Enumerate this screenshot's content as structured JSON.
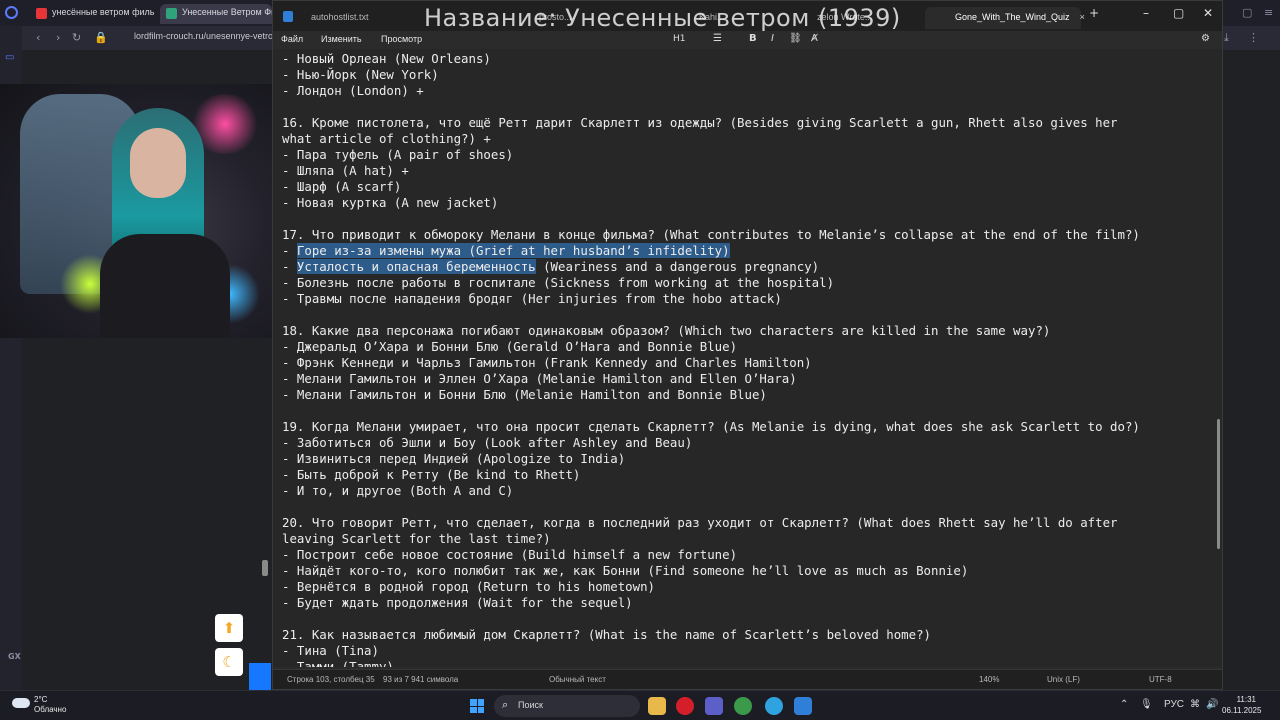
{
  "overlay_title": "Название: Унесенные ветром (1939)",
  "browser": {
    "tabs": [
      {
        "label": "унесённые ветром филь",
        "icon": "yandex-icon",
        "color": "#e8353a"
      },
      {
        "label": "Унесенные Ветром Фи",
        "icon": "film-icon",
        "color": "#2fa37a"
      }
    ],
    "url": "lordfilm-crouch.ru/unesennye-vetrom-",
    "sidebar_label": "GX"
  },
  "notepad": {
    "tabs": [
      {
        "label": "autohostlist.txt"
      },
      {
        "label": "prosto..."
      },
      {
        "label": "Kahi..."
      },
      {
        "label": "zelon Wrote..."
      },
      {
        "label": "Gone_With_The_Wind_Quiz"
      }
    ],
    "menu": {
      "file": "Файл",
      "edit": "Изменить",
      "view": "Просмотр"
    },
    "format": {
      "heading": "H1",
      "bold": "B",
      "italic": "I"
    },
    "lines": [
      "- Новый Орлеан (New Orleans)",
      "- Нью-Йорк (New York)",
      "- Лондон (London) +",
      "",
      "16. Кроме пистолета, что ещё Ретт дарит Скарлетт из одежды? (Besides giving Scarlett a gun, Rhett also gives her",
      "what article of clothing?) +",
      "- Пара туфель (A pair of shoes)",
      "- Шляпа (A hat) +",
      "- Шарф (A scarf)",
      "- Новая куртка (A new jacket)",
      "",
      "17. Что приводит к обмороку Мелани в конце фильма? (What contributes to Melanie’s collapse at the end of the film?)",
      "- Горе из-за измены мужа (Grief at her husband’s infidelity)",
      "- Усталость и опасная беременность (Weariness and a dangerous pregnancy)",
      "- Болезнь после работы в госпитале (Sickness from working at the hospital)",
      "- Травмы после нападения бродяг (Her injuries from the hobo attack)",
      "",
      "18. Какие два персонажа погибают одинаковым образом? (Which two characters are killed in the same way?)",
      "- Джеральд О’Хара и Бонни Блю (Gerald O’Hara and Bonnie Blue)",
      "- Фрэнк Кеннеди и Чарльз Гамильтон (Frank Kennedy and Charles Hamilton)",
      "- Мелани Гамильтон и Эллен О’Хара (Melanie Hamilton and Ellen O’Hara)",
      "- Мелани Гамильтон и Бонни Блю (Melanie Hamilton and Bonnie Blue)",
      "",
      "19. Когда Мелани умирает, что она просит сделать Скарлетт? (As Melanie is dying, what does she ask Scarlett to do?)",
      "- Заботиться об Эшли и Боу (Look after Ashley and Beau)",
      "- Извиниться перед Индией (Apologize to India)",
      "- Быть доброй к Ретту (Be kind to Rhett)",
      "- И то, и другое (Both A and C)",
      "",
      "20. Что говорит Ретт, что сделает, когда в последний раз уходит от Скарлетт? (What does Rhett say he’ll do after",
      "leaving Scarlett for the last time?)",
      "- Построит себе новое состояние (Build himself a new fortune)",
      "- Найдёт кого-то, кого полюбит так же, как Бонни (Find someone he’ll love as much as Bonnie)",
      "- Вернётся в родной город (Return to his hometown)",
      "- Будет ждать продолжения (Wait for the sequel)",
      "",
      "21. Как называется любимый дом Скарлетт? (What is the name of Scarlett’s beloved home?)",
      "- Тина (Tina)",
      "- Тамми (Tammy)"
    ],
    "status": {
      "position": "Строка 103, столбец 35",
      "selection": "93 из 7 941 символа",
      "mode": "Обычный текст",
      "zoom": "140%",
      "line_ending": "Unix (LF)",
      "encoding": "UTF-8"
    }
  },
  "taskbar": {
    "weather_temp": "2°C",
    "weather_desc": "Облачно",
    "search": "Поиск",
    "lang": "РУС",
    "time": "11:31",
    "date": "06.11.2025"
  }
}
